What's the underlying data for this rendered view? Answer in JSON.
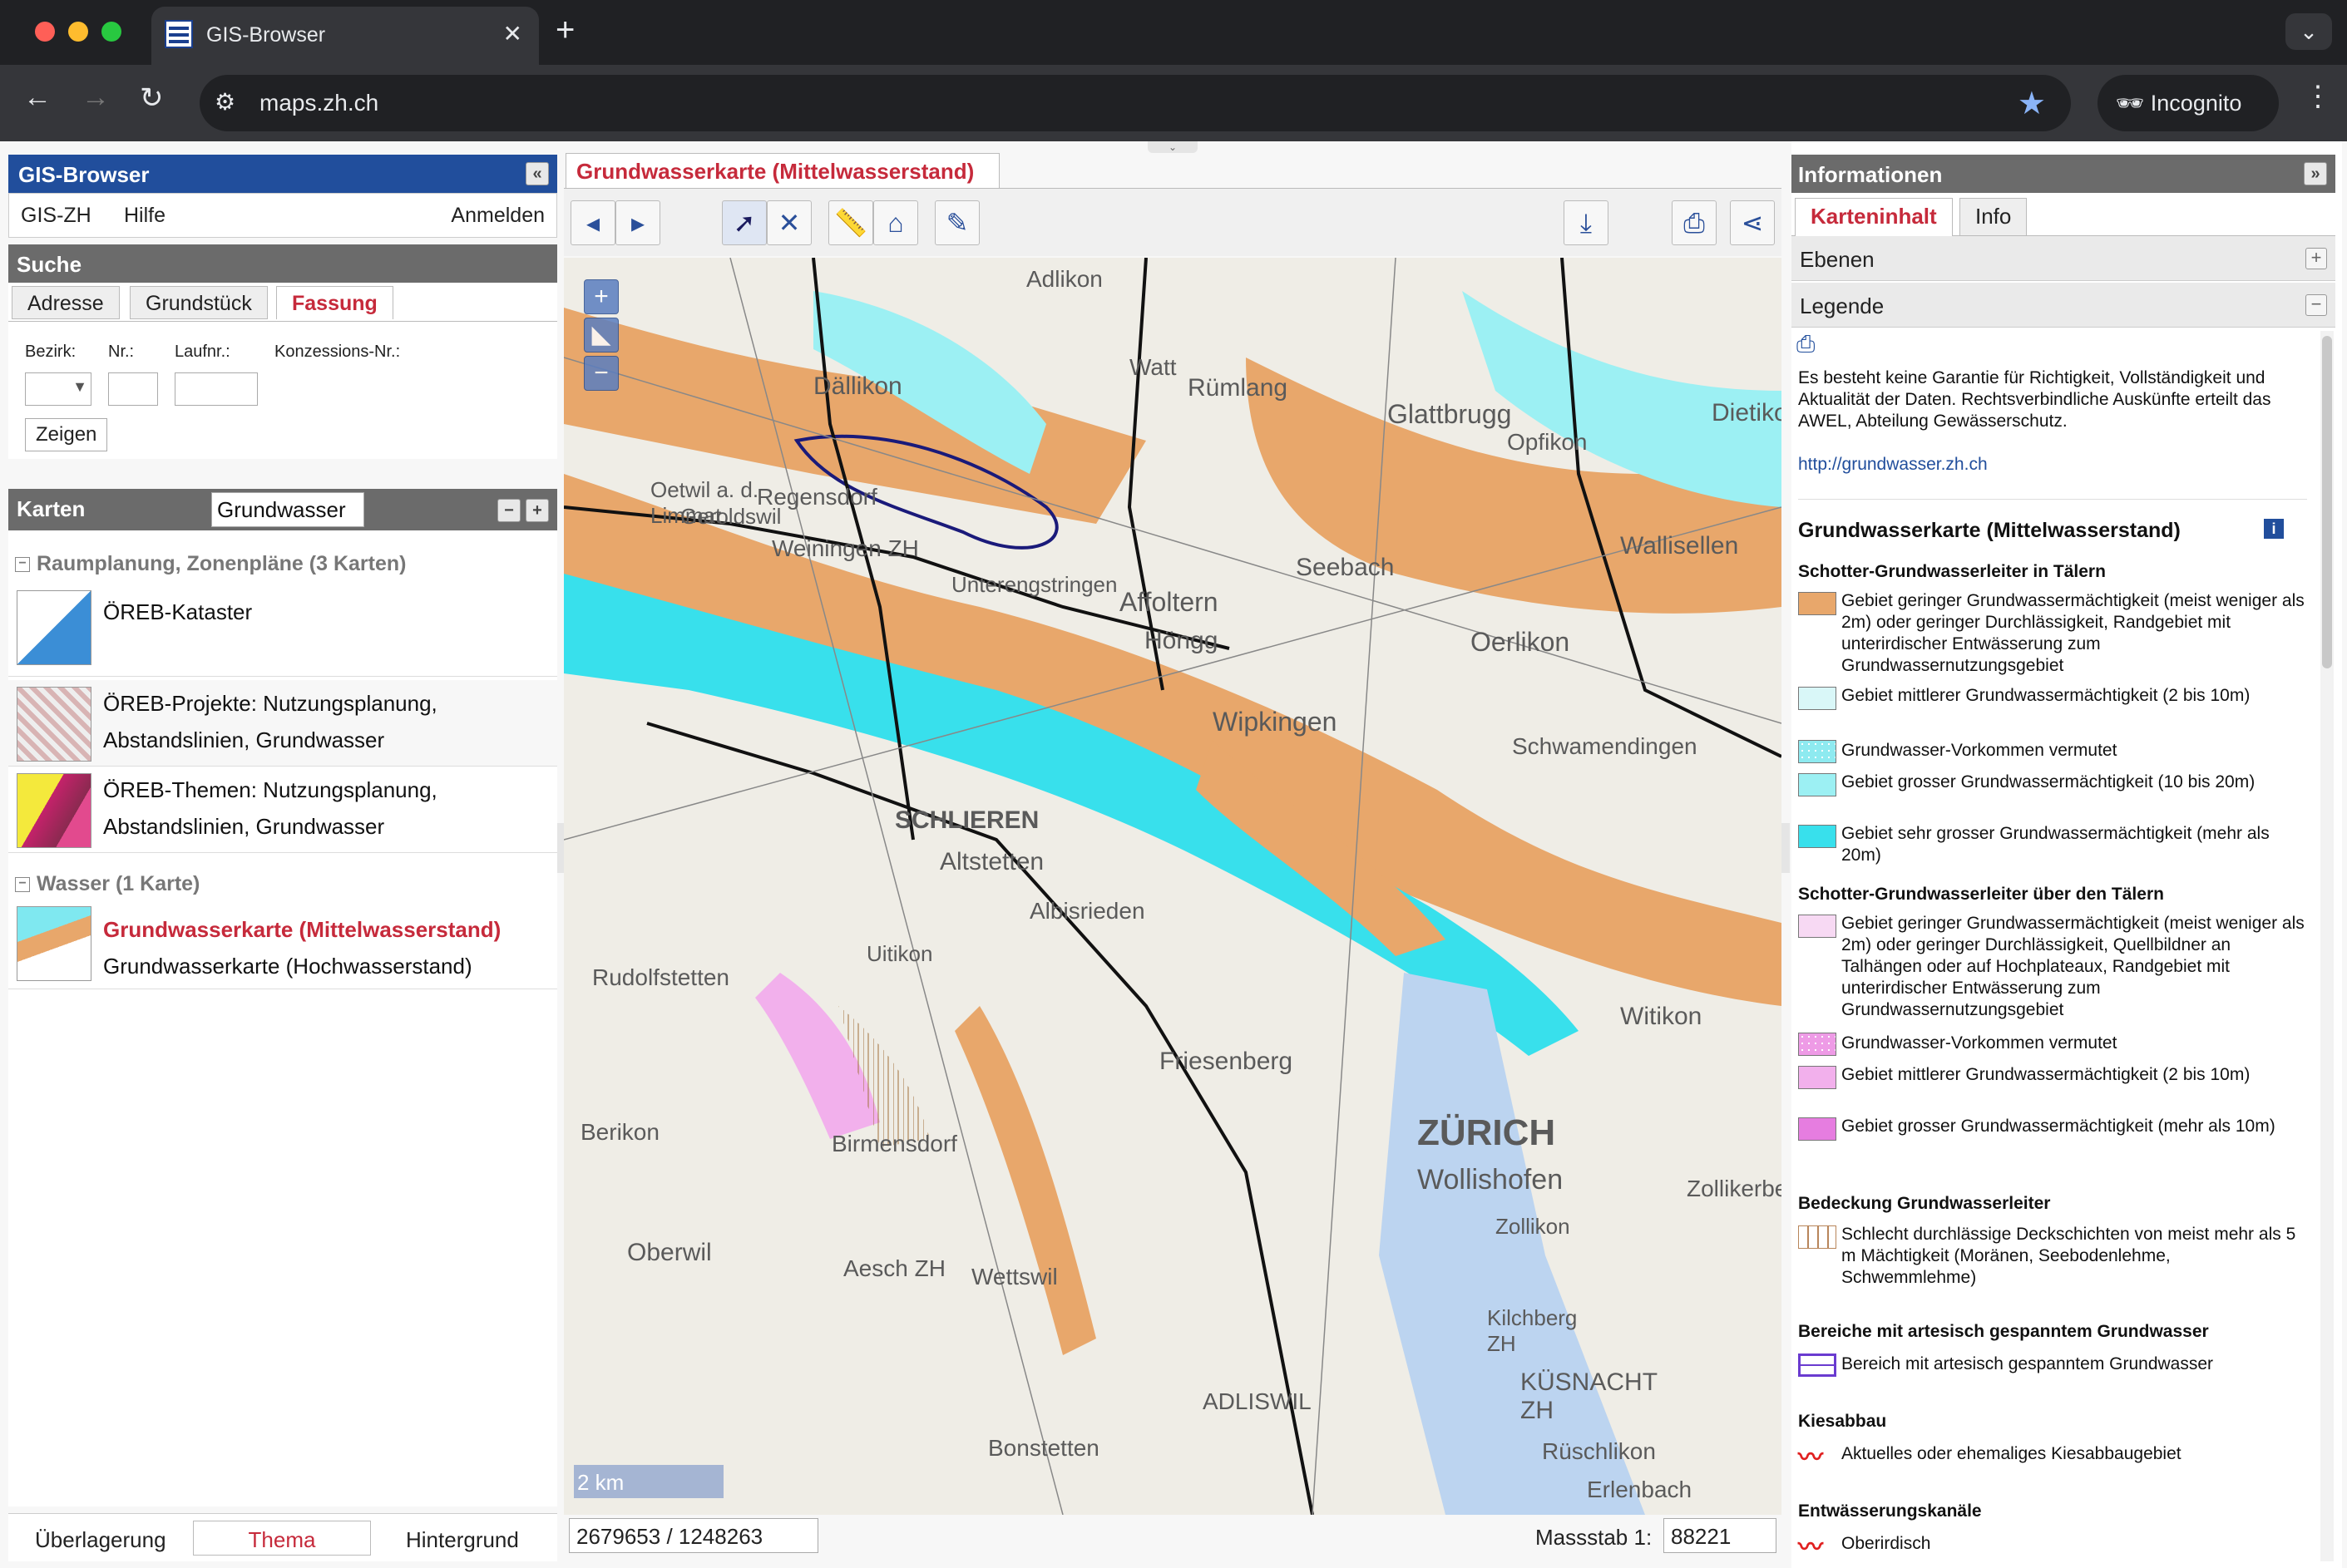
{
  "browser": {
    "tab_title": "GIS-Browser",
    "url": "maps.zh.ch",
    "incognito_label": "Incognito",
    "new_tab": "+",
    "close": "✕"
  },
  "left": {
    "header": "GIS-Browser",
    "menu": {
      "gis_zh": "GIS-ZH",
      "help": "Hilfe",
      "login": "Anmelden"
    },
    "search": {
      "title": "Suche",
      "tabs": [
        "Adresse",
        "Grundstück",
        "Fassung"
      ],
      "active_tab": "Fassung",
      "labels": {
        "bezirk": "Bezirk:",
        "nr": "Nr.:",
        "laufnr": "Laufnr.:",
        "konz": "Konzessions-Nr.:"
      },
      "show_button": "Zeigen"
    },
    "maps": {
      "title": "Karten",
      "filter_value": "Grundwasser",
      "groups": [
        {
          "name": "Raumplanung, Zonenpläne (3 Karten)",
          "items": [
            "ÖREB-Kataster",
            "ÖREB-Projekte: Nutzungsplanung, Abstandslinien, Grundwasser",
            "ÖREB-Themen: Nutzungsplanung, Abstandslinien, Grundwasser"
          ]
        },
        {
          "name": "Wasser (1 Karte)",
          "items": [
            "Grundwasserkarte (Mittelwasserstand)",
            "Grundwasserkarte (Hochwasserstand)"
          ]
        }
      ]
    },
    "bottom_tabs": [
      "Überlagerung",
      "Thema",
      "Hintergrund"
    ],
    "active_bottom": "Thema"
  },
  "center": {
    "map_tab": "Grundwasserkarte (Mittelwasserstand)",
    "coords": "2679653 / 1248263",
    "scale_label": "Massstab 1:",
    "scale_value": "88221",
    "map_labels": [
      "ZÜRICH",
      "Wollishofen",
      "Oerlikon",
      "Affoltern",
      "Höngg",
      "Wipkingen",
      "SCHLIEREN",
      "Altstetten",
      "Rümlang",
      "Glattbrugg",
      "Opfikon",
      "Seebach",
      "Dällikon",
      "Regensdorf",
      "Weiningen ZH",
      "Schwamendingen",
      "Zollikon",
      "Kilchberg ZH",
      "KÜSNACHT ZH",
      "ADLISWIL",
      "Birmensdorf",
      "Friesenberg",
      "Albisrieden",
      "Rudolfstetten",
      "Berikon",
      "Oberwil",
      "Wettswil",
      "Bonstetten",
      "Aesch ZH",
      "Witikon",
      "Wallisellen",
      "Adlikon",
      "Watt",
      "Oetwil a. d. Limmat",
      "Geroldswil",
      "Unterengstringen",
      "Uitikon",
      "Erlenbach",
      "Rüschlikon",
      "Zollikerberg",
      "Dietikon"
    ],
    "scalebar": "2 km"
  },
  "right": {
    "header": "Informationen",
    "tabs": [
      "Karteninhalt",
      "Info"
    ],
    "active_tab": "Karteninhalt",
    "sections": {
      "layers": "Ebenen",
      "legend": "Legende"
    },
    "disclaimer": "Es besteht keine Garantie für Richtigkeit, Vollständigkeit und Aktualität der Daten. Rechtsverbindliche Auskünfte erteilt das AWEL, Abteilung Gewässerschutz.",
    "link": "http://grundwasser.zh.ch",
    "legend_title": "Grundwasserkarte (Mittelwasserstand)",
    "groups": [
      {
        "title": "Schotter-Grundwasserleiter in Tälern",
        "items": [
          {
            "color": "#e8a76b",
            "text": "Gebiet geringer Grundwassermächtigkeit (meist weniger als 2m) oder geringer Durchlässigkeit, Randgebiet mit unterirdischer Entwässerung zum Grundwassernutzungsgebiet"
          },
          {
            "color": "#d9f7f8",
            "text": "Gebiet mittlerer Grundwassermächtigkeit (2 bis 10m)"
          },
          {
            "color": "#8eeaf0",
            "text": "Grundwasser-Vorkommen vermutet"
          },
          {
            "color": "#9cf0f3",
            "text": "Gebiet grosser Grundwassermächtigkeit (10 bis 20m)"
          },
          {
            "color": "#38e0ec",
            "text": "Gebiet sehr grosser Grundwassermächtigkeit (mehr als 20m)"
          }
        ]
      },
      {
        "title": "Schotter-Grundwasserleiter über den Tälern",
        "items": [
          {
            "color": "#f7d9f3",
            "text": "Gebiet geringer Grundwassermächtigkeit (meist weniger als 2m) oder geringer Durchlässigkeit, Quellbildner an Talhängen oder auf Hochplateaux, Randgebiet mit unterirdischer Entwässerung zum Grundwassernutzungsgebiet"
          },
          {
            "color": "#ee9be6",
            "text": "Grundwasser-Vorkommen vermutet"
          },
          {
            "color": "#f2b0ec",
            "text": "Gebiet mittlerer Grundwassermächtigkeit (2 bis 10m)"
          },
          {
            "color": "#e67de0",
            "text": "Gebiet grosser Grundwassermächtigkeit (mehr als 10m)"
          }
        ]
      },
      {
        "title": "Bedeckung Grundwasserleiter",
        "items": [
          {
            "color": "#ffffff",
            "text": "Schlecht durchlässige Deckschichten von meist mehr als 5 m Mächtigkeit (Moränen, Seebodenlehme, Schwemmlehme)"
          }
        ]
      },
      {
        "title": "Bereiche mit artesisch gespanntem Grundwasser",
        "items": [
          {
            "color": "#ffffff",
            "text": "Bereich mit artesisch gespanntem Grundwasser"
          }
        ]
      },
      {
        "title": "Kiesabbau",
        "items": [
          {
            "color": "#ffffff",
            "text": "Aktuelles oder ehemaliges Kiesabbaugebiet"
          }
        ]
      },
      {
        "title": "Entwässerungskanäle",
        "items": [
          {
            "color": "#ffffff",
            "text": "Oberirdisch"
          }
        ]
      }
    ]
  },
  "icons": {
    "back": "arrow-left-icon",
    "forward": "arrow-right-icon",
    "reload": "reload-icon",
    "star": "star-icon",
    "print": "print-icon",
    "info": "info-icon"
  }
}
